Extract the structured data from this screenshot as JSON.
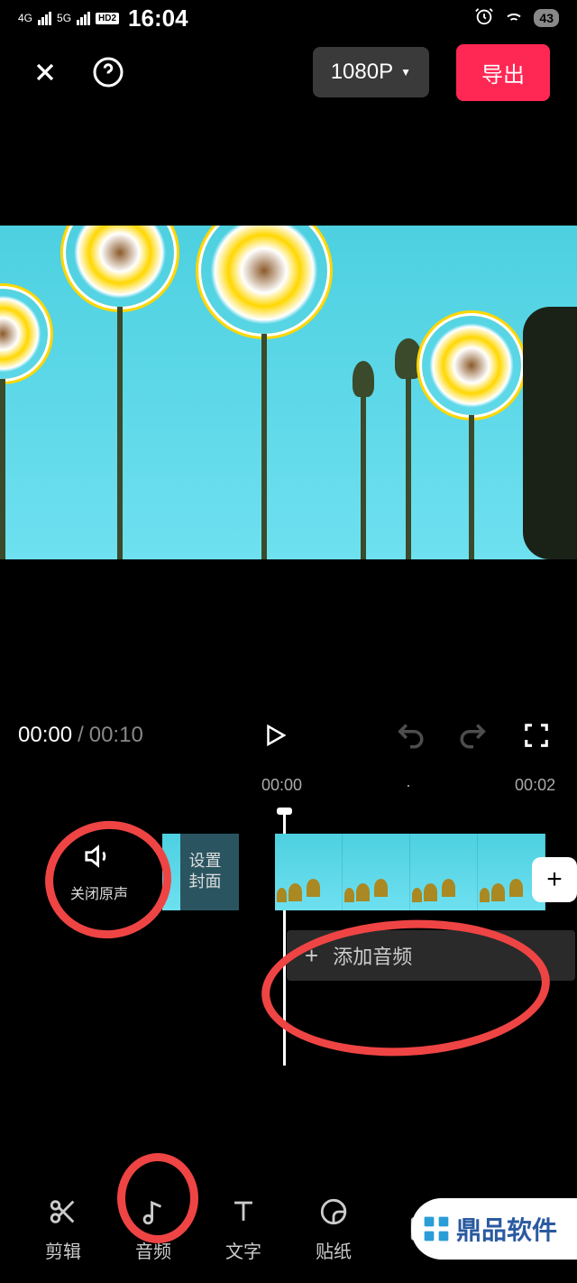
{
  "status": {
    "net1": "4G",
    "net2": "5G",
    "hd": "HD2",
    "time": "16:04",
    "battery": "43"
  },
  "toolbar": {
    "resolution": "1080P",
    "export": "导出"
  },
  "player": {
    "current": "00:00",
    "sep": " / ",
    "total": "00:10"
  },
  "ruler": {
    "t0": "00:00",
    "t1": "00:02"
  },
  "timeline": {
    "mute": "关闭原声",
    "cover": "设置\n封面",
    "add_audio": "添加音频"
  },
  "tools": [
    {
      "label": "剪辑"
    },
    {
      "label": "音频"
    },
    {
      "label": "文字"
    },
    {
      "label": "贴纸"
    }
  ],
  "watermark": "鼎品软件"
}
